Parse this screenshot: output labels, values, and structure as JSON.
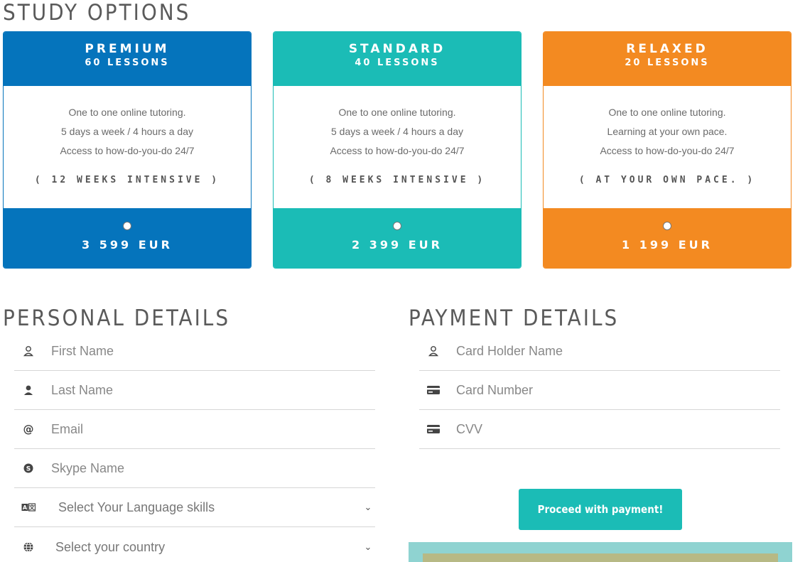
{
  "titles": {
    "study": "STUDY OPTIONS",
    "personal": "PERSONAL DETAILS",
    "payment": "PAYMENT DETAILS"
  },
  "plans": [
    {
      "name": "PREMIUM",
      "lessons": "60 LESSONS",
      "features": [
        "One to one online tutoring.",
        "5 days a week / 4 hours a day",
        "Access to how-do-you-do 24/7"
      ],
      "duration": "( 12 WEEKS INTENSIVE )",
      "price": "3 599 EUR",
      "color": "#0574bc"
    },
    {
      "name": "STANDARD",
      "lessons": "40 LESSONS",
      "features": [
        "One to one online tutoring.",
        "5 days a week / 4 hours a day",
        "Access to how-do-you-do 24/7"
      ],
      "duration": "( 8 WEEKS INTENSIVE )",
      "price": "2 399 EUR",
      "color": "#1bbcb6"
    },
    {
      "name": "RELAXED",
      "lessons": "20 LESSONS",
      "features": [
        "One to one online tutoring.",
        "Learning at your own pace.",
        "Access to how-do-you-do 24/7"
      ],
      "duration": "( AT YOUR OWN PACE. )",
      "price": "1 199 EUR",
      "color": "#f38a21"
    }
  ],
  "personal": {
    "first_name": {
      "placeholder": "First Name",
      "icon": "user-outline-icon"
    },
    "last_name": {
      "placeholder": "Last Name",
      "icon": "user-solid-icon"
    },
    "email": {
      "placeholder": "Email",
      "icon": "at-icon"
    },
    "skype": {
      "placeholder": "Skype Name",
      "icon": "skype-icon"
    },
    "language": {
      "value": "Select Your Language skills",
      "icon": "language-icon"
    },
    "country": {
      "value": "Select your country",
      "icon": "globe-icon"
    }
  },
  "payment": {
    "holder": {
      "placeholder": "Card Holder Name",
      "icon": "user-outline-icon"
    },
    "number": {
      "placeholder": "Card Number",
      "icon": "credit-card-icon"
    },
    "cvv": {
      "placeholder": "CVV",
      "icon": "credit-card-icon"
    },
    "button": "Proceed with payment!"
  }
}
